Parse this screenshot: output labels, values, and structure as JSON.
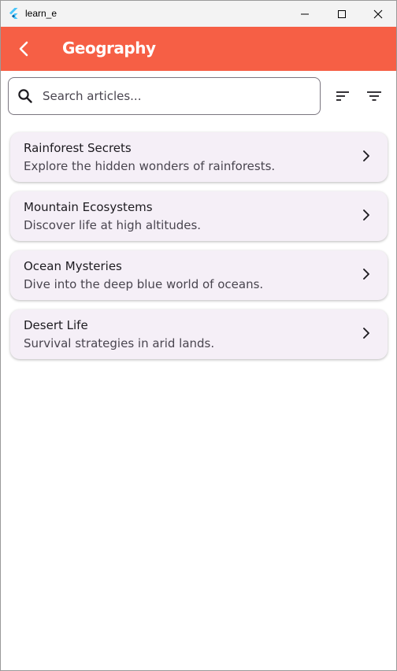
{
  "window": {
    "title": "learn_e",
    "controls": [
      "minimize-icon",
      "maximize-icon",
      "close-icon"
    ]
  },
  "appbar": {
    "title": "Geography",
    "back_icon": "chevron-left-icon",
    "background": "#f65f45"
  },
  "search": {
    "placeholder": "Search articles...",
    "value": ""
  },
  "toolbar": {
    "sort_icon": "sort-icon",
    "filter_icon": "filter-icon"
  },
  "articles": [
    {
      "title": "Rainforest Secrets",
      "subtitle": "Explore the hidden wonders of rainforests."
    },
    {
      "title": "Mountain Ecosystems",
      "subtitle": "Discover life at high altitudes."
    },
    {
      "title": "Ocean Mysteries",
      "subtitle": "Dive into the deep blue world of oceans."
    },
    {
      "title": "Desert Life",
      "subtitle": "Survival strategies in arid lands."
    }
  ],
  "colors": {
    "card_background": "#f5eff7",
    "accent": "#f65f45"
  }
}
